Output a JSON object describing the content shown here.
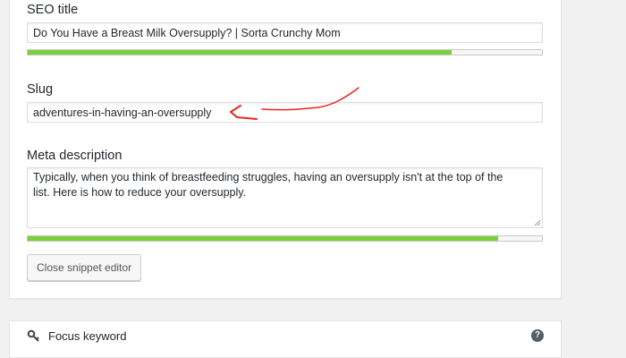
{
  "seo_title": {
    "label": "SEO title",
    "value": "Do You Have a Breast Milk Oversupply? | Sorta Crunchy Mom",
    "progress": 0.825,
    "progress_color": "#7ad03a"
  },
  "slug": {
    "label": "Slug",
    "value": "adventures-in-having-an-oversupply"
  },
  "meta_description": {
    "label": "Meta description",
    "value": "Typically, when you think of breastfeeding struggles, having an oversupply isn't at the top of the list. Here is how to reduce your oversupply.",
    "progress": 0.915,
    "progress_color": "#7ad03a"
  },
  "buttons": {
    "close_snippet_editor": "Close snippet editor"
  },
  "focus_keyword": {
    "label": "Focus keyword",
    "icon": "key-icon",
    "help_icon": "question-circle-icon",
    "help_glyph": "?"
  },
  "annotation": {
    "color": "#e8261f"
  }
}
